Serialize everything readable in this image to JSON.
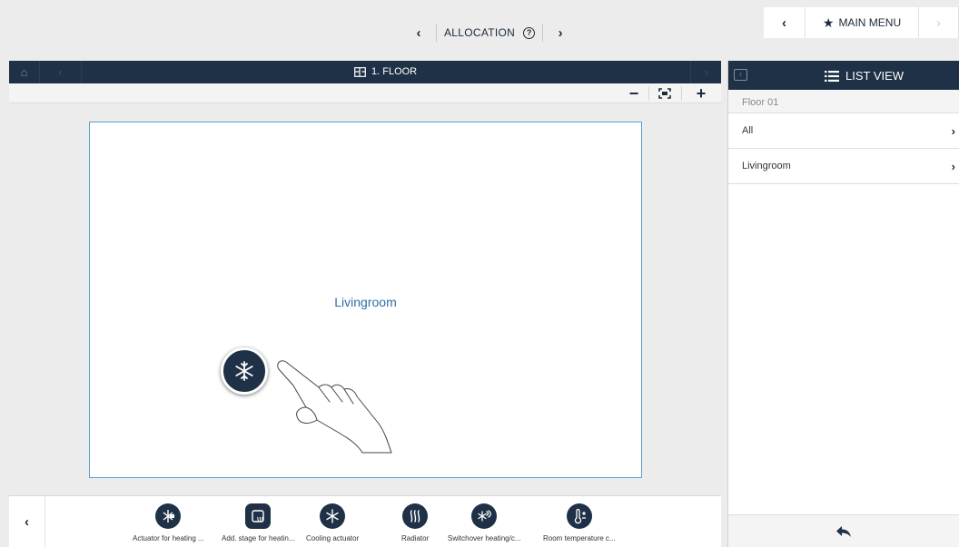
{
  "top_nav": {
    "title": "ALLOCATION",
    "prev_glyph": "‹",
    "next_glyph": "›",
    "help_glyph": "?"
  },
  "main_menu": {
    "label": "MAIN MENU",
    "back_glyph": "‹",
    "fwd_glyph": "›",
    "icon": "star-icon"
  },
  "floor_bar": {
    "title": "1. FLOOR",
    "home_glyph": "⌂",
    "prev_glyph": "‹",
    "next_glyph": "›"
  },
  "zoom": {
    "minus": "−",
    "plus": "+"
  },
  "floorplan": {
    "room_label": "Livingroom",
    "dragged_device_icon": "snowflake-icon"
  },
  "device_bar": {
    "left_glyph": "‹",
    "devices": [
      {
        "label": "Actuator for heating ...",
        "icon": "heating-actuator-icon"
      },
      {
        "label": "Add. stage for heatin...",
        "icon": "add-stage-icon"
      },
      {
        "label": "Cooling actuator",
        "icon": "snowflake-icon"
      },
      {
        "label": "Radiator",
        "icon": "radiator-icon"
      },
      {
        "label": "Switchover heating/c...",
        "icon": "switchover-icon"
      },
      {
        "label": "Room temperature c...",
        "icon": "thermometer-icon"
      }
    ]
  },
  "list_view": {
    "title": "LIST VIEW",
    "breadcrumb": "Floor 01",
    "items": [
      {
        "label": "All",
        "arrow": "›"
      },
      {
        "label": "Livingroom",
        "arrow": "›"
      }
    ],
    "footer_icon": "reply-arrow-icon"
  },
  "colors": {
    "navy": "#1f3146",
    "accent_blue": "#5aa0d0",
    "room_text": "#2c6ea6"
  }
}
